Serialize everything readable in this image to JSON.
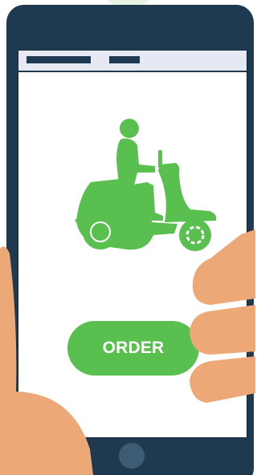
{
  "screen": {
    "order_button_label": "ORDER"
  },
  "icons": {
    "scooter": "scooter-rider-icon",
    "home": "home-button"
  },
  "colors": {
    "phone_body": "#1f3a50",
    "accent_green": "#59bf4f",
    "skin": "#eda878",
    "status_bar": "#e6e8f4"
  }
}
